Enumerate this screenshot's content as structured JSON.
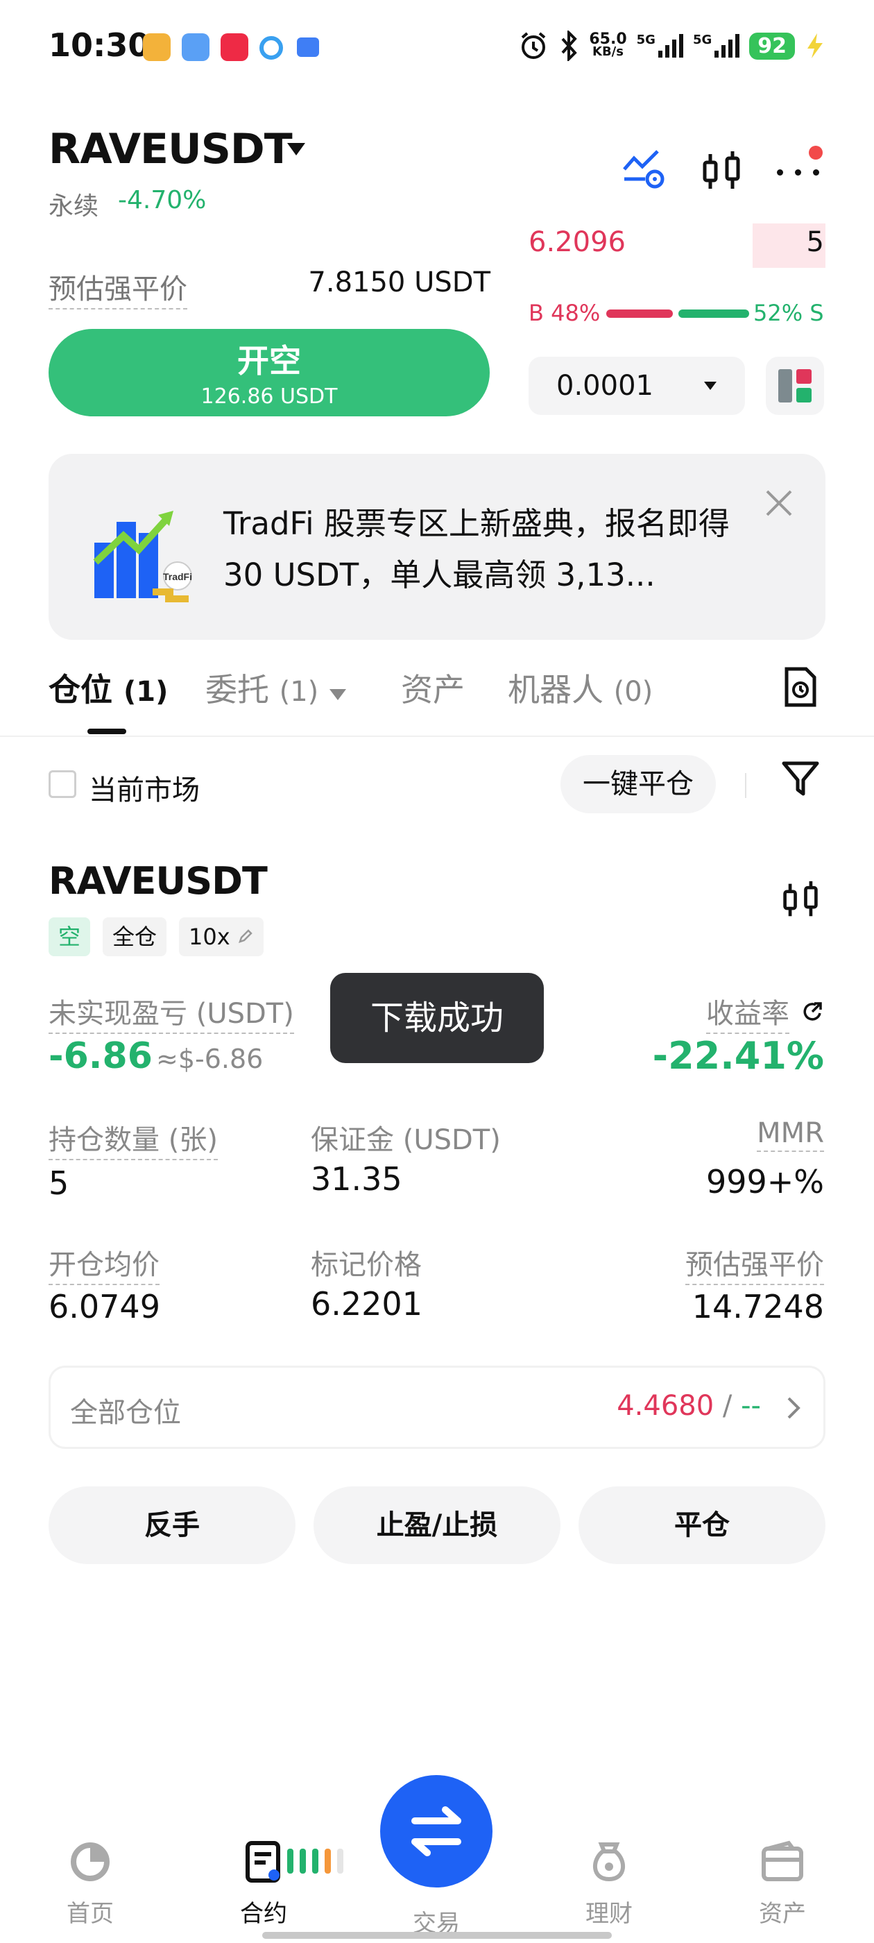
{
  "status_bar": {
    "time": "10:30",
    "net_speed_value": "65.0",
    "net_speed_unit": "KB/s",
    "sig1": "5G",
    "sig2": "5G",
    "battery": "92"
  },
  "header": {
    "pair": "RAVEUSDT",
    "type_label": "永续",
    "change": "-4.70%"
  },
  "orderbook": {
    "ask_price": "6.2096",
    "ask_qty": "5",
    "buy_ratio_label": "B 48%",
    "sell_ratio_label": "52% S",
    "buy_ratio": 0.48,
    "precision": "0.0001"
  },
  "order_form": {
    "est_liq_label": "预估强平价",
    "est_liq_value": "7.8150 USDT",
    "open_short_label": "开空",
    "open_short_amount": "126.86 USDT"
  },
  "banner": {
    "badge": "TradFi",
    "text": "TradFi 股票专区上新盛典，报名即得 30 USDT，单人最高领 3,13..."
  },
  "tabs": {
    "positions": "仓位",
    "positions_count": "(1)",
    "orders": "委托",
    "orders_count": "(1)",
    "assets": "资产",
    "bots": "机器人",
    "bots_count": "(0)"
  },
  "filter": {
    "current_market": "当前市场",
    "close_all": "一键平仓"
  },
  "position": {
    "symbol": "RAVEUSDT",
    "side": "空",
    "margin_mode": "全仓",
    "leverage": "10x",
    "upl_label": "未实现盈亏 (USDT)",
    "upl_value": "-6.86",
    "upl_approx": "≈$-6.86",
    "roe_label": "收益率",
    "roe_value": "-22.41%",
    "size_label": "持仓数量 (张)",
    "size_value": "5",
    "margin_label": "保证金 (USDT)",
    "margin_value": "31.35",
    "mmr_label": "MMR",
    "mmr_value": "999+%",
    "entry_label": "开仓均价",
    "entry_value": "6.0749",
    "mark_label": "标记价格",
    "mark_value": "6.2201",
    "liq_label": "预估强平价",
    "liq_value": "14.7248"
  },
  "toast": "下载成功",
  "all_positions": {
    "label": "全部仓位",
    "value": "4.4680",
    "sep": "/",
    "other": "--"
  },
  "actions": {
    "reverse": "反手",
    "tpsl": "止盈/止损",
    "close": "平仓"
  },
  "nav": {
    "home": "首页",
    "futures": "合约",
    "trade": "交易",
    "earn": "理财",
    "assets": "资产"
  },
  "colors": {
    "green": "#23b26d",
    "red": "#e0365a",
    "orange": "#f5973a",
    "blue": "#1e62f5"
  }
}
